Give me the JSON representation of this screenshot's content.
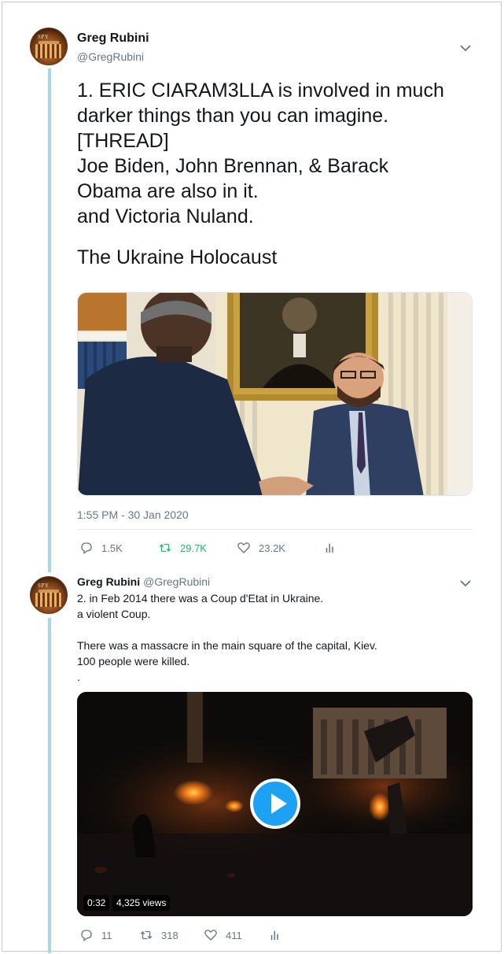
{
  "tweet1": {
    "author_name": "Greg Rubini",
    "author_handle": "@GregRubini",
    "avatar_text": "SPY",
    "lines": [
      "1. ERIC CIARAM3LLA is involved in much",
      "darker things than you can imagine.",
      "[THREAD]",
      "Joe Biden, John Brennan, & Barack",
      "Obama are also in it.",
      "and Victoria Nuland."
    ],
    "line_after_gap": "The Ukraine Holocaust",
    "timestamp": "1:55 PM - 30 Jan 2020",
    "replies": "1.5K",
    "retweets": "29.7K",
    "likes": "23.2K",
    "retweet_color": "#17bf63"
  },
  "tweet2": {
    "author_name": "Greg Rubini",
    "author_handle": "@GregRubini",
    "avatar_text": "SPY",
    "lines": [
      "2. in Feb 2014 there was a Coup d'Etat in Ukraine.",
      "a violent Coup.",
      "",
      "There was a massacre in the main square of the capital, Kiev.",
      "100 people were killed.",
      "."
    ],
    "video_duration": "0:32",
    "video_views": "4,325 views",
    "replies": "11",
    "retweets": "318",
    "likes": "411"
  },
  "icons": {
    "menu": "chevron-down-icon",
    "reply": "reply-icon",
    "retweet": "retweet-icon",
    "like": "heart-icon",
    "analytics": "analytics-icon",
    "play": "play-icon"
  },
  "colors": {
    "accent": "#1da1f2",
    "thread_line": "#a8d6ef",
    "muted": "#657786"
  }
}
